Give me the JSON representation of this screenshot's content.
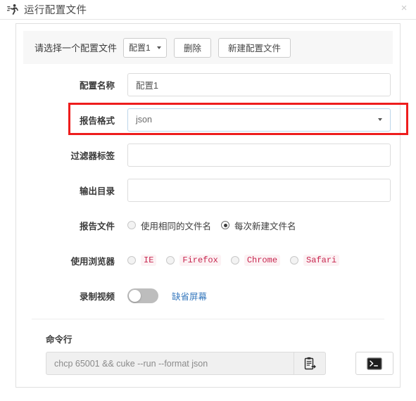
{
  "window": {
    "title": "运行配置文件",
    "icon": "running-person-icon",
    "close_label": "×"
  },
  "profile_bar": {
    "lead_label": "请选择一个配置文件",
    "selected_profile": "配置1",
    "delete_label": "删除",
    "new_label": "新建配置文件"
  },
  "form": {
    "name": {
      "label": "配置名称",
      "value": "配置1",
      "placeholder": ""
    },
    "report_format": {
      "label": "报告格式",
      "value": "json",
      "highlighted": true,
      "highlight_color": "#ee1d1d"
    },
    "filter_tags": {
      "label": "过滤器标签",
      "value": "",
      "placeholder": ""
    },
    "output_dir": {
      "label": "输出目录",
      "value": "",
      "placeholder": ""
    },
    "report_file": {
      "label": "报告文件",
      "options": [
        {
          "label": "使用相同的文件名",
          "selected": false
        },
        {
          "label": "每次新建文件名",
          "selected": true
        }
      ]
    },
    "browser": {
      "label": "使用浏览器",
      "code_color": "#c7254e",
      "options": [
        {
          "label": "IE",
          "selected": false
        },
        {
          "label": "Firefox",
          "selected": false
        },
        {
          "label": "Chrome",
          "selected": false
        },
        {
          "label": "Safari",
          "selected": false
        }
      ]
    },
    "record_video": {
      "label": "录制视频",
      "enabled": false,
      "link_label": "缺省屏幕",
      "link_color": "#3a7bbf"
    }
  },
  "command_line": {
    "title": "命令行",
    "value": "chcp 65001 && cuke --run --format json",
    "copy_icon": "clipboard-paste-icon",
    "terminal_icon": "terminal-icon"
  }
}
